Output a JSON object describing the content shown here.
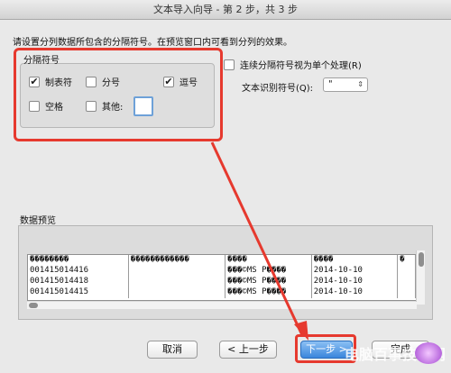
{
  "window": {
    "title": "文本导入向导 - 第 2 步，共 3 步"
  },
  "instruction": "请设置分列数据所包含的分隔符号。在预览窗口内可看到分列的效果。",
  "delimiters": {
    "legend": "分隔符号",
    "tab": {
      "label": "制表符",
      "checked": true
    },
    "semicolon": {
      "label": "分号",
      "checked": false
    },
    "comma": {
      "label": "逗号",
      "checked": true
    },
    "space": {
      "label": "空格",
      "checked": false
    },
    "other": {
      "label": "其他:",
      "checked": false,
      "value": ""
    }
  },
  "consecutive": {
    "label": "连续分隔符号视为单个处理(R)",
    "checked": false
  },
  "qualifier": {
    "label": "文本识别符号(Q):",
    "value": "\""
  },
  "preview": {
    "label": "数据预览",
    "rows": [
      [
        "��������",
        "������������",
        "����",
        "����",
        "�"
      ],
      [
        "001415014416",
        "",
        "���©MS P����",
        "2014-10-10",
        ""
      ],
      [
        "001415014418",
        "",
        "���©MS P����",
        "2014-10-10",
        ""
      ],
      [
        "001415014415",
        "",
        "���©MS P����",
        "2014-10-10",
        ""
      ]
    ]
  },
  "buttons": {
    "cancel": "取消",
    "back": "< 上一步",
    "next": "下一步 >",
    "finish": "完成"
  },
  "watermark": "电脑百事技术网"
}
